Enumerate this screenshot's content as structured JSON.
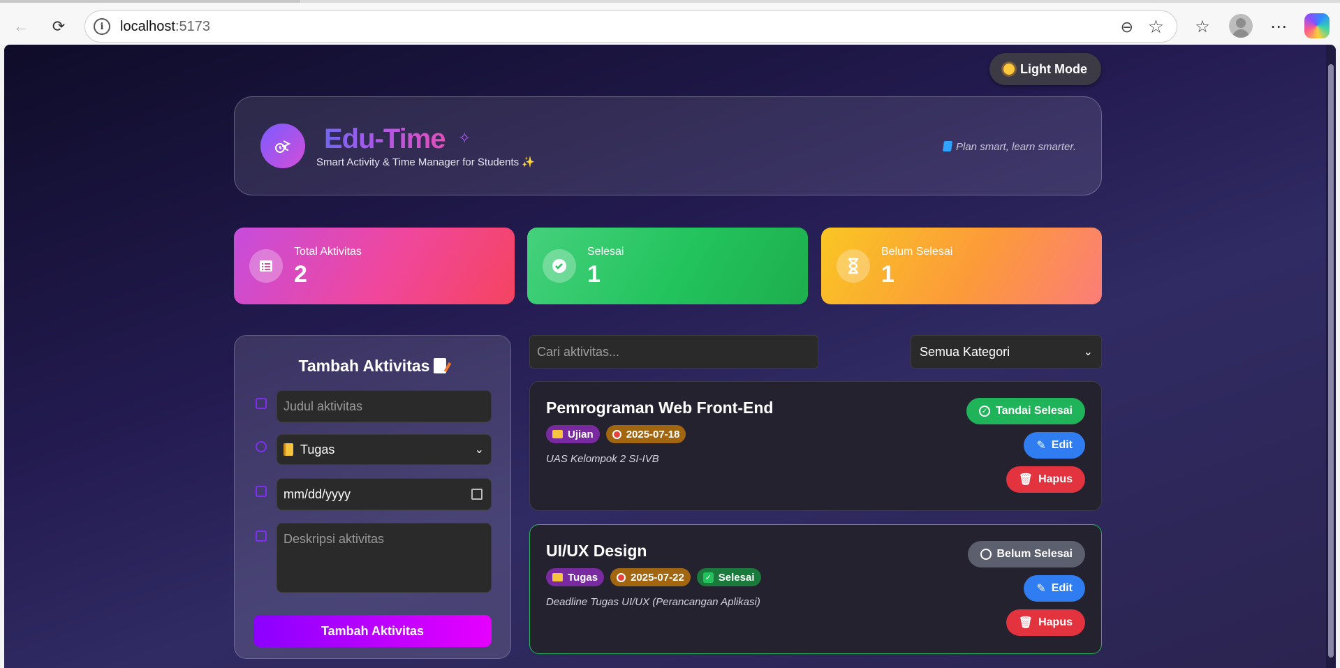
{
  "browser": {
    "url_host": "localhost",
    "url_port": ":5173"
  },
  "theme_toggle": {
    "label": "Light Mode"
  },
  "header": {
    "title": "Edu-Time",
    "subtitle": "Smart Activity & Time Manager for Students ✨",
    "tagline": "Plan smart, learn smarter."
  },
  "stats": [
    {
      "label": "Total Aktivitas",
      "value": "2",
      "icon": "list-icon"
    },
    {
      "label": "Selesai",
      "value": "1",
      "icon": "check-circle-icon"
    },
    {
      "label": "Belum Selesai",
      "value": "1",
      "icon": "hourglass-icon"
    }
  ],
  "form": {
    "title": "Tambah Aktivitas",
    "title_placeholder": "Judul aktivitas",
    "category_value": "Tugas",
    "date_placeholder": "mm/dd/yyyy",
    "desc_placeholder": "Deskripsi aktivitas",
    "submit_label": "Tambah Aktivitas"
  },
  "filters": {
    "search_placeholder": "Cari aktivitas...",
    "category_selected": "Semua Kategori"
  },
  "activities": [
    {
      "name": "Pemrograman Web Front-End",
      "category": "Ujian",
      "date": "2025-07-18",
      "description": "UAS Kelompok 2 SI-IVB",
      "toggle_label": "Tandai Selesai",
      "edit_label": "Edit",
      "delete_label": "Hapus"
    },
    {
      "name": "UI/UX Design",
      "category": "Tugas",
      "date": "2025-07-22",
      "status": "Selesai",
      "description": "Deadline Tugas UI/UX (Perancangan Aplikasi)",
      "toggle_label": "Belum Selesai",
      "edit_label": "Edit",
      "delete_label": "Hapus"
    }
  ],
  "colors": {
    "accent_purple": "#8b00ff",
    "accent_magenta": "#e600ff",
    "success": "#1fb35a",
    "primary": "#2f7df0",
    "danger": "#e2333f"
  }
}
